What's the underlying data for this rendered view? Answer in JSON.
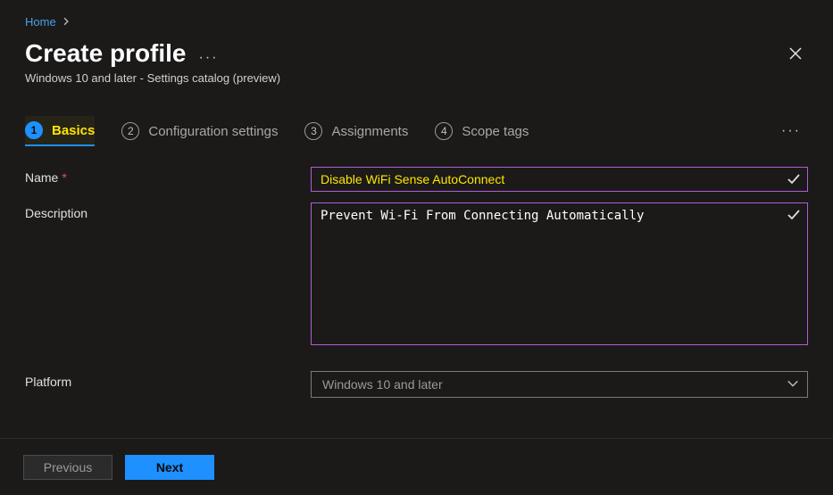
{
  "breadcrumb": {
    "home": "Home"
  },
  "header": {
    "title": "Create profile",
    "subtitle": "Windows 10 and later - Settings catalog (preview)"
  },
  "tabs": {
    "items": [
      {
        "num": "1",
        "label": "Basics"
      },
      {
        "num": "2",
        "label": "Configuration settings"
      },
      {
        "num": "3",
        "label": "Assignments"
      },
      {
        "num": "4",
        "label": "Scope tags"
      }
    ]
  },
  "form": {
    "name_label": "Name",
    "name_value": "Disable WiFi Sense AutoConnect",
    "description_label": "Description",
    "description_value": "Prevent Wi-Fi From Connecting Automatically",
    "platform_label": "Platform",
    "platform_value": "Windows 10 and later"
  },
  "footer": {
    "previous": "Previous",
    "next": "Next"
  }
}
